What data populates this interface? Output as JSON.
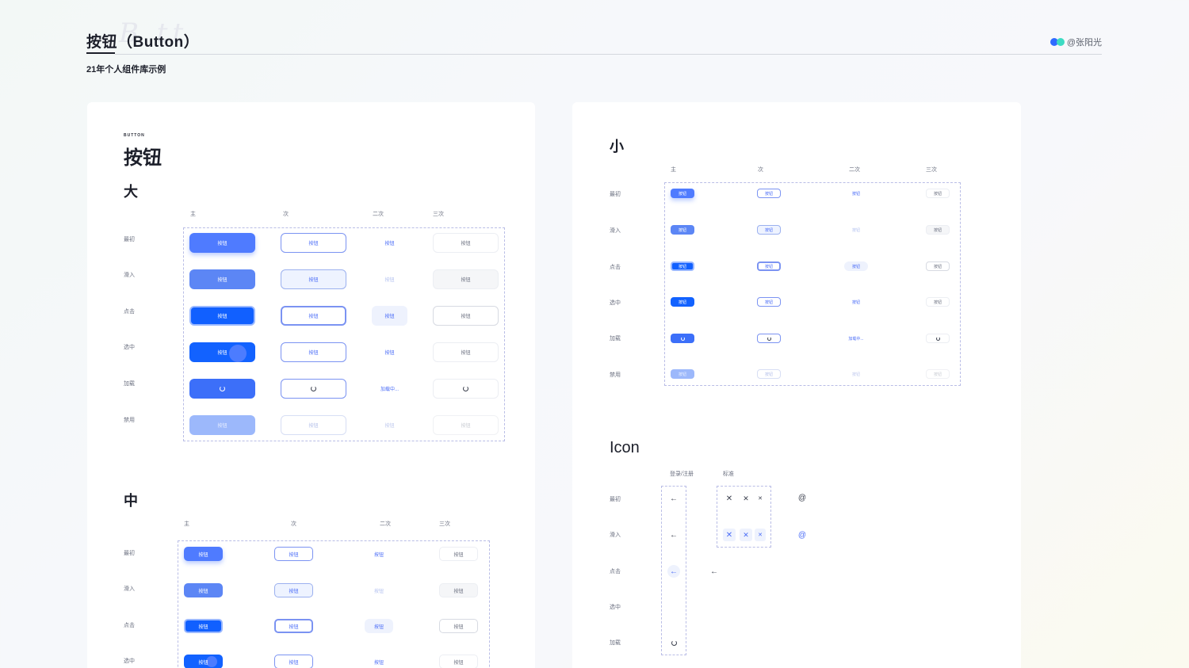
{
  "header": {
    "title": "按钮（Button）",
    "subtitle": "21年个人组件库示例",
    "author": "@张阳光",
    "accent_colors": [
      "#2f6bff",
      "#3ddbc3"
    ]
  },
  "columns": [
    "主",
    "次",
    "二次",
    "三次"
  ],
  "rows": [
    "最初",
    "滑入",
    "点击",
    "选中",
    "加载",
    "禁用"
  ],
  "button_label": "按钮",
  "loading_label": "加载中...",
  "left_card": {
    "eyebrow": "BUTTON",
    "title": "按钮",
    "large_title": "大",
    "medium_title": "中"
  },
  "right_card": {
    "small_title": "小",
    "icon_title": "Icon",
    "icon_columns": [
      "登录/注册",
      "标准"
    ],
    "icon_rows": [
      "最初",
      "滑入",
      "点击",
      "选中",
      "加载"
    ],
    "icons": {
      "back": "arrow-left-icon",
      "close": "close-icon",
      "at": "at-icon",
      "loading": "spinner-icon"
    },
    "at_glyph": "@",
    "back_glyph": "←",
    "close_glyph": "✕"
  },
  "colors": {
    "primary": "#4f7bff",
    "primary_pressed": "#1160ff",
    "primary_disabled": "#9cb8fb",
    "outline": "#7b93f2",
    "dash_border": "#b9bde6"
  }
}
